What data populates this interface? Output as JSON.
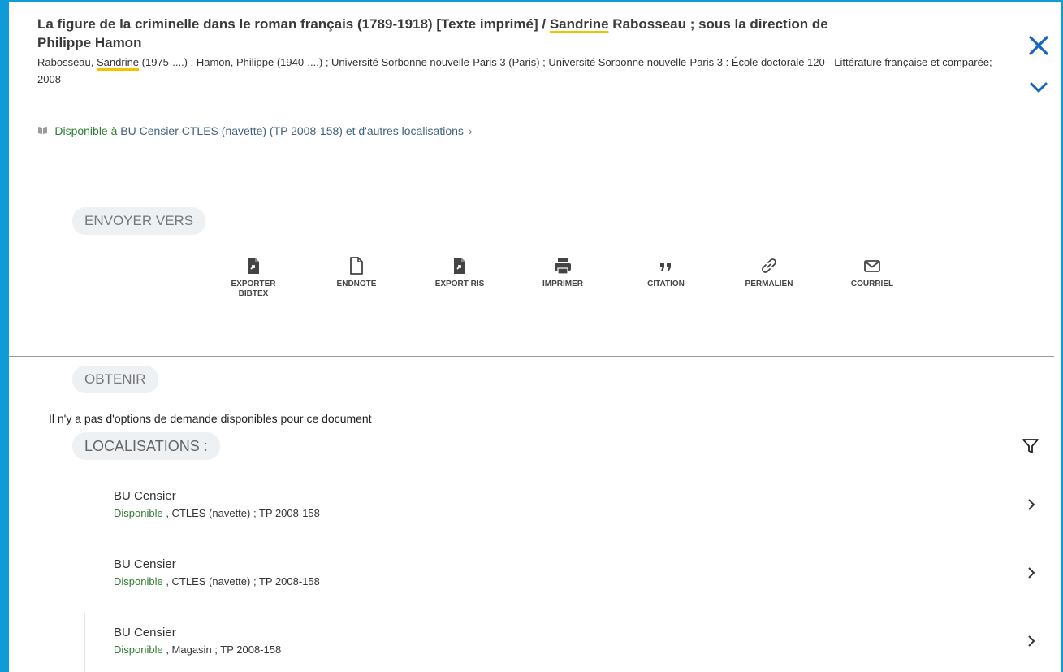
{
  "record": {
    "title_part1": "La figure de la criminelle dans le roman français (1789-1918) [Texte imprimé] / ",
    "title_highlight": "Sandrine",
    "title_part2": " Rabosseau ; sous la direction de Philippe Hamon",
    "authors_part1": "Rabosseau, ",
    "authors_highlight": "Sandrine",
    "authors_part2": " (1975-....) ; Hamon, Philippe (1940-....) ; Université Sorbonne nouvelle-Paris 3 (Paris) ; Université Sorbonne nouvelle-Paris 3 : École doctorale 120 - Littérature française et comparée;",
    "year": "2008"
  },
  "availability": {
    "label": "Disponible à",
    "location": "BU Censier  CTLES (navette) (TP 2008-158) et d'autres localisations",
    "chevron": "›"
  },
  "send_to": {
    "heading": "ENVOYER VERS",
    "actions": [
      {
        "label": "EXPORTER BIBTEX",
        "icon": "export-bibtex-icon"
      },
      {
        "label": "ENDNOTE",
        "icon": "endnote-icon"
      },
      {
        "label": "EXPORT RIS",
        "icon": "export-ris-icon"
      },
      {
        "label": "IMPRIMER",
        "icon": "print-icon"
      },
      {
        "label": "CITATION",
        "icon": "quote-icon"
      },
      {
        "label": "PERMALIEN",
        "icon": "link-icon"
      },
      {
        "label": "COURRIEL",
        "icon": "mail-icon"
      }
    ]
  },
  "obtain": {
    "heading": "OBTENIR",
    "message": "Il n'y a pas d'options de demande disponibles pour ce document",
    "locations_heading": "LOCALISATIONS :"
  },
  "locations": [
    {
      "library": "BU Censier",
      "status": "Disponible",
      "details": " , CTLES (navette) ; TP 2008-158"
    },
    {
      "library": "BU Censier",
      "status": "Disponible",
      "details": " , CTLES (navette) ; TP 2008-158"
    },
    {
      "library": "BU Censier",
      "status": "Disponible",
      "details": " , Magasin ; TP 2008-158"
    }
  ],
  "colors": {
    "accent": "#0f9ad8",
    "title_icon_blue": "#1565c0",
    "available_green": "#2e7d32",
    "highlight": "#f3c300"
  }
}
